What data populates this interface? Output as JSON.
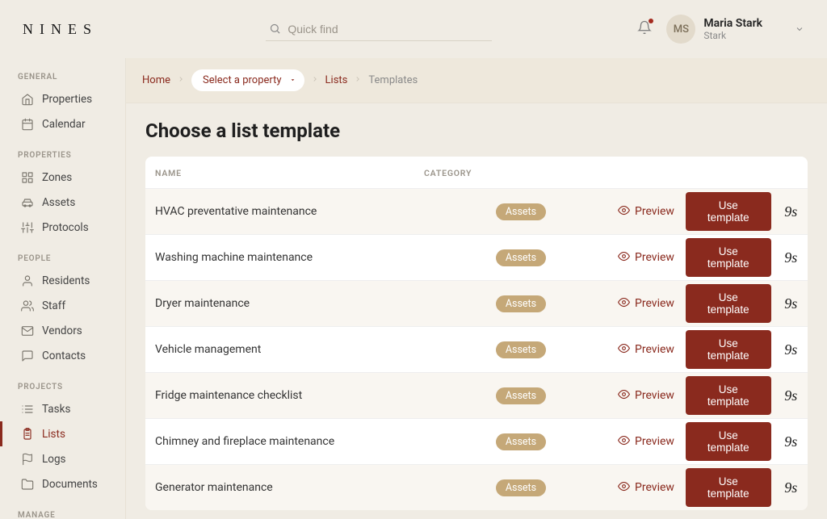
{
  "header": {
    "logo": "NINES",
    "search_placeholder": "Quick find",
    "user": {
      "initials": "MS",
      "name": "Maria Stark",
      "subtitle": "Stark"
    }
  },
  "sidebar": {
    "groups": [
      {
        "label": "GENERAL",
        "items": [
          {
            "id": "properties",
            "label": "Properties"
          },
          {
            "id": "calendar",
            "label": "Calendar"
          }
        ]
      },
      {
        "label": "PROPERTIES",
        "items": [
          {
            "id": "zones",
            "label": "Zones"
          },
          {
            "id": "assets",
            "label": "Assets"
          },
          {
            "id": "protocols",
            "label": "Protocols"
          }
        ]
      },
      {
        "label": "PEOPLE",
        "items": [
          {
            "id": "residents",
            "label": "Residents"
          },
          {
            "id": "staff",
            "label": "Staff"
          },
          {
            "id": "vendors",
            "label": "Vendors"
          },
          {
            "id": "contacts",
            "label": "Contacts"
          }
        ]
      },
      {
        "label": "PROJECTS",
        "items": [
          {
            "id": "tasks",
            "label": "Tasks"
          },
          {
            "id": "lists",
            "label": "Lists",
            "active": true
          },
          {
            "id": "logs",
            "label": "Logs"
          },
          {
            "id": "documents",
            "label": "Documents"
          }
        ]
      },
      {
        "label": "MANAGE",
        "items": []
      }
    ]
  },
  "breadcrumb": {
    "home": "Home",
    "select_property": "Select a property",
    "lists": "Lists",
    "templates": "Templates"
  },
  "page": {
    "title": "Choose a list template",
    "columns": {
      "name": "NAME",
      "category": "CATEGORY"
    },
    "preview_label": "Preview",
    "use_label": "Use template",
    "brand_mark": "9s",
    "rows": [
      {
        "name": "HVAC preventative maintenance",
        "category": "Assets"
      },
      {
        "name": "Washing machine maintenance",
        "category": "Assets"
      },
      {
        "name": "Dryer maintenance",
        "category": "Assets"
      },
      {
        "name": "Vehicle management",
        "category": "Assets"
      },
      {
        "name": "Fridge maintenance checklist",
        "category": "Assets"
      },
      {
        "name": "Chimney and fireplace maintenance",
        "category": "Assets"
      },
      {
        "name": "Generator maintenance",
        "category": "Assets"
      }
    ]
  },
  "icons": {
    "properties": "home",
    "calendar": "calendar",
    "zones": "grid",
    "assets": "car",
    "protocols": "sliders",
    "residents": "user",
    "staff": "users",
    "vendors": "mail",
    "contacts": "message",
    "tasks": "list",
    "lists": "clipboard",
    "logs": "flag",
    "documents": "folder"
  }
}
